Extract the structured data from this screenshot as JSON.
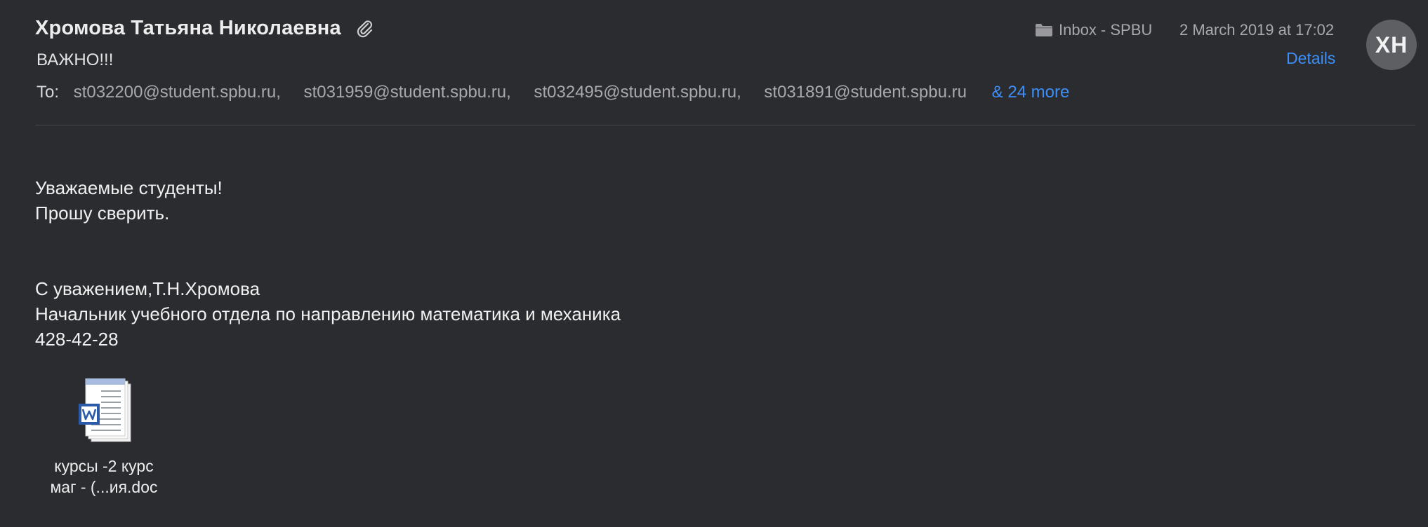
{
  "header": {
    "sender_name": "Хромова Татьяна Николаевна",
    "subject": "ВАЖНО!!!",
    "to_label": "To:",
    "recipients": [
      "st032200@student.spbu.ru,",
      "st031959@student.spbu.ru,",
      "st032495@student.spbu.ru,",
      "st031891@student.spbu.ru"
    ],
    "more_recipients": "& 24 more",
    "mailbox": "Inbox - SPBU",
    "date": "2 March 2019 at 17:02",
    "details_label": "Details",
    "avatar_initials": "XH",
    "icons": {
      "attachment": "paperclip-icon",
      "mailbox": "folder-icon"
    }
  },
  "body": {
    "lines": [
      "Уважаемые студенты!",
      "Прошу сверить.",
      "С уважением,Т.Н.Хромова",
      "Начальник учебного отдела по направлению математика и механика",
      "428-42-28"
    ]
  },
  "attachment": {
    "name_line1": "курсы -2 курс",
    "name_line2": "маг - (...ия.doc",
    "icon": "word-document-icon"
  },
  "colors": {
    "background": "#2b2c2f",
    "link": "#3e8ef7",
    "avatar": "#5e5f63"
  }
}
